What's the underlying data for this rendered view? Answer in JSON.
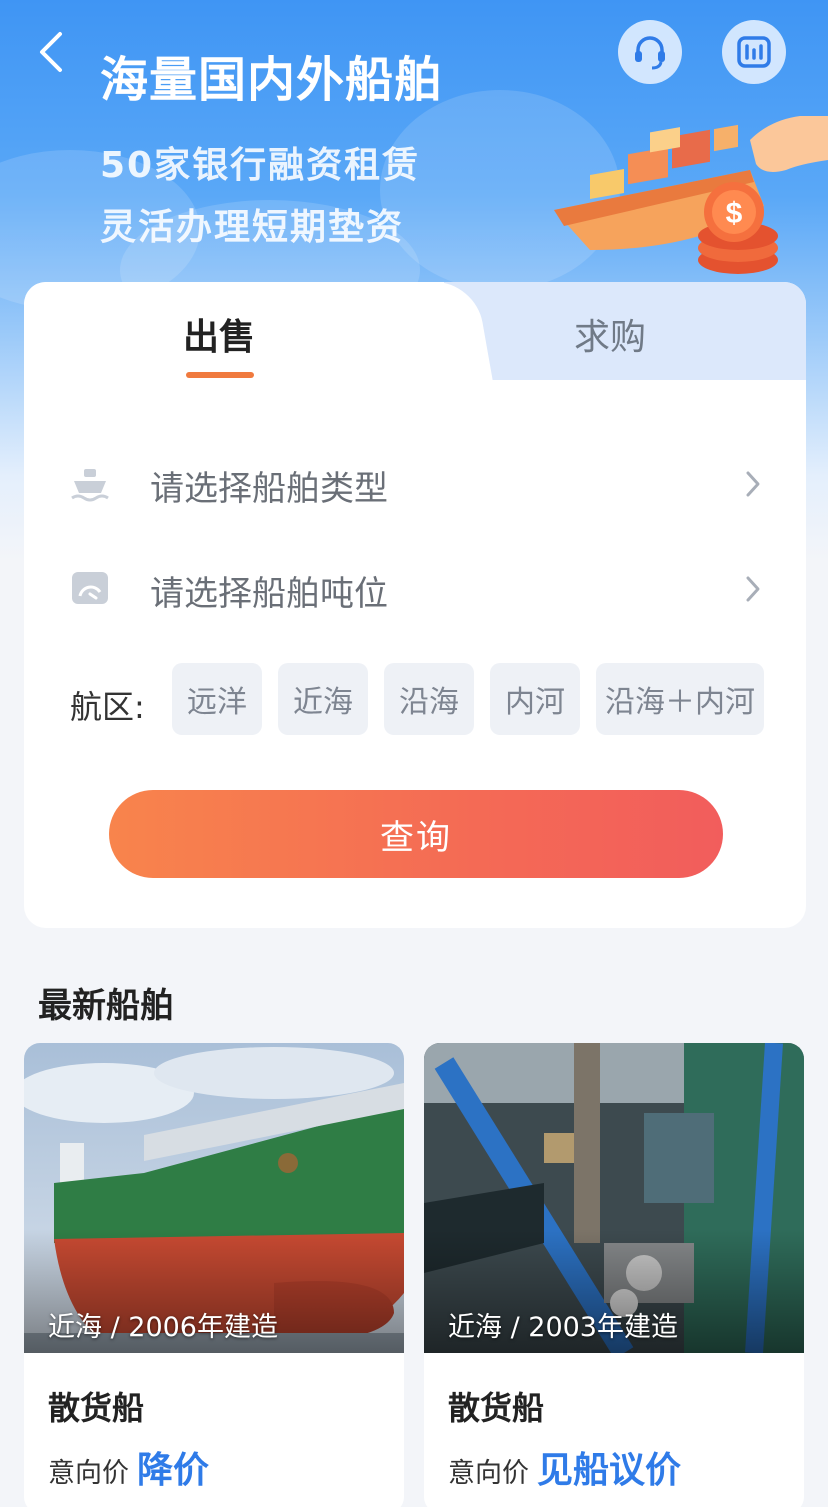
{
  "header": {
    "title": "海量国内外船舶",
    "subtitle_line1": "50家银行融资租赁",
    "subtitle_line2": "灵活办理短期垫资",
    "icons": [
      "back-icon",
      "customer-service-icon",
      "data-report-icon"
    ]
  },
  "tabs": [
    {
      "label": "出售",
      "active": true
    },
    {
      "label": "求购",
      "active": false
    }
  ],
  "filters": {
    "ship_type_placeholder": "请选择船舶类型",
    "tonnage_placeholder": "请选择船舶吨位",
    "area_label": "航区:",
    "areas": [
      "远洋",
      "近海",
      "沿海",
      "内河",
      "沿海＋内河"
    ]
  },
  "query_button": "查询",
  "latest": {
    "title": "最新船舶",
    "items": [
      {
        "meta": "近海 / 2006年建造",
        "type": "散货船",
        "price_label": "意向价",
        "price": "降价"
      },
      {
        "meta": "近海 / 2003年建造",
        "type": "散货船",
        "price_label": "意向价",
        "price": "见船议价"
      }
    ]
  },
  "colors": {
    "accent_orange": "#f07a3e",
    "price_blue": "#2f7be8",
    "hero_blue": "#3f95f4"
  }
}
